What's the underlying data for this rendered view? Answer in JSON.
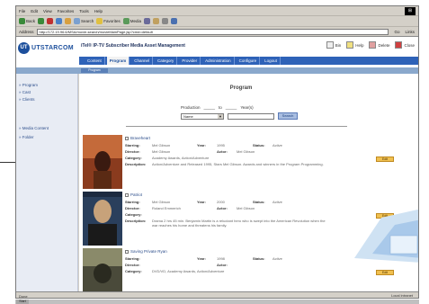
{
  "browser": {
    "menu": [
      "File",
      "Edit",
      "View",
      "Favorites",
      "Tools",
      "Help"
    ],
    "toolbar": {
      "back": "Back",
      "search": "Search",
      "favorites": "Favorites",
      "media": "Media"
    },
    "address_label": "Address",
    "address_value": "http://172.19.96.6/MSA/movie-search/movieMainPage.jsp?cmd=default",
    "go": "Go",
    "links": "Links"
  },
  "app": {
    "logo_letters": "UT",
    "logo_text": "UTSTARCOM",
    "title": "iTel® IP-TV Subscriber Media Asset Management",
    "header_links": [
      "Bin",
      "Help",
      "Delete",
      "Close"
    ],
    "nav": [
      {
        "label": "Content",
        "active": false
      },
      {
        "label": "Program",
        "active": true
      },
      {
        "label": "Channel",
        "active": false
      },
      {
        "label": "Category",
        "active": false
      },
      {
        "label": "Provider",
        "active": false
      },
      {
        "label": "Administration",
        "active": false
      },
      {
        "label": "Configure",
        "active": false
      },
      {
        "label": "Logout",
        "active": false
      }
    ],
    "sub_pill": "Program"
  },
  "sidebar": {
    "items": [
      "Program",
      "Cast",
      "Clients"
    ],
    "items2": [
      "Media Content",
      "Folder"
    ]
  },
  "page": {
    "title": "Program",
    "search": {
      "label_from": "Production",
      "label_to": "to",
      "label_year": "Year(s)",
      "select_value": "Name",
      "button": "Search"
    }
  },
  "labels": {
    "starring": "Starring:",
    "director": "Director:",
    "category": "Category:",
    "description": "Description:",
    "year": "Year:",
    "actor": "Actor:",
    "status": "Status:",
    "edit": "Edit"
  },
  "movies": [
    {
      "title": "Braveheart",
      "starring": "Mel Gibson",
      "director": "Mel Gibson",
      "category": "Academy Awards, Action/Adventure",
      "description": "Action/Adventure and Released 1995, Stars Mel Gibson. Awards and winners in the Program Programming.",
      "year": "1995",
      "actor": "Mel Gibson",
      "status": "Active",
      "poster_colors": [
        "#8a3b1e",
        "#c46a3a",
        "#3a1a10"
      ]
    },
    {
      "title": "Patriot",
      "starring": "Mel Gibson",
      "director": "Roland Emmerich",
      "category": "",
      "description": "Drama 2 hrs 45 min. Benjamin Martin is a reluctant hero who is swept into the American Revolution when the war reaches his home and threatens his family.",
      "year": "2000",
      "actor": "Mel Gibson",
      "status": "Active",
      "poster_colors": [
        "#2a3f5c",
        "#c7a27a",
        "#1a1a1a"
      ]
    },
    {
      "title": "Saving Private Ryan",
      "starring": "",
      "director": "",
      "category": "DVD/VD, Academy Awards, Action/Adventure",
      "description": "",
      "year": "1998",
      "actor": "",
      "status": "Active",
      "poster_colors": [
        "#4a4a3a",
        "#8a8a6a",
        "#2a2a20"
      ]
    }
  ],
  "status": {
    "text": "Done",
    "zone": "Local intranet"
  },
  "taskbar": {
    "start": "Start"
  }
}
